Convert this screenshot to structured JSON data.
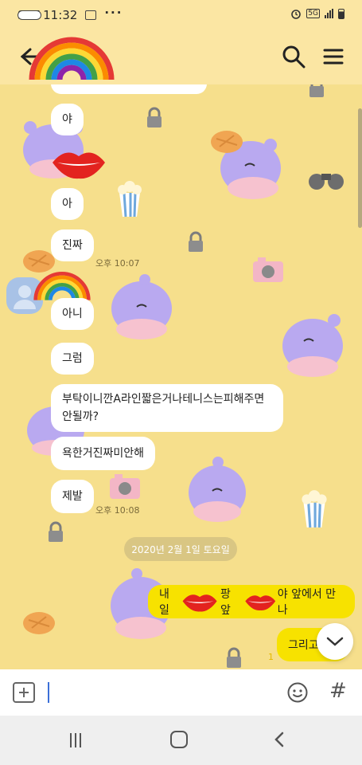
{
  "status_bar": {
    "carrier_time": "SKT 11:32",
    "network_badge": "5G",
    "icons": [
      "talk-notification-icon",
      "gallery-notification-icon",
      "more-dots-icon",
      "alarm-icon",
      "wifi-icon",
      "signal-icon",
      "battery-icon"
    ]
  },
  "header": {
    "back_icon": "back-arrow-icon",
    "search_icon": "search-icon",
    "menu_icon": "hamburger-menu-icon",
    "sticker": "rainbow-sticker"
  },
  "messages_received": [
    {
      "text": "야"
    },
    {
      "text": "아"
    },
    {
      "text": "진짜",
      "time": "오후 10:07"
    },
    {
      "text": "아니"
    },
    {
      "text": "그럼"
    },
    {
      "text_line1": "부탁이니깐A라인짧은거나테니스는피해주면",
      "text_line2": "안될까?"
    },
    {
      "text": "욕한거진짜미안해"
    },
    {
      "text": "제발",
      "time": "오후 10:08"
    }
  ],
  "date_divider": "2020년 2월 1일 토요일",
  "messages_sent": [
    {
      "text_a": "내일",
      "text_b": "팡 앞",
      "text_c": "야 앞에서 만나"
    },
    {
      "text": "그리고",
      "unread": "1"
    }
  ],
  "input": {
    "placeholder": "",
    "attach_icon": "plus-box-icon",
    "emoji_icon": "emoticon-icon",
    "hash_icon": "#"
  },
  "nav": {
    "recent_icon": "recent-apps-icon",
    "home_icon": "home-icon",
    "back_icon": "nav-back-icon"
  },
  "colors": {
    "background": "#f6df8c",
    "my_bubble": "#f7e200",
    "date_chip": "#d9c683",
    "header": "#fbe6a3"
  }
}
